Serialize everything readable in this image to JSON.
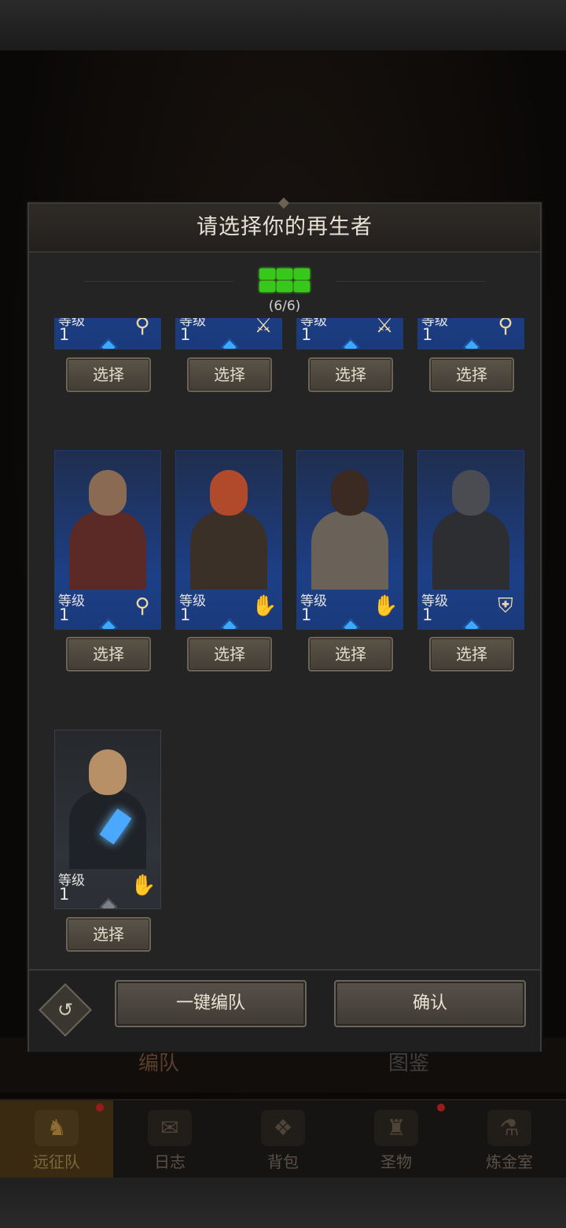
{
  "modal": {
    "title": "请选择你的再生者",
    "counter_text": "(6/6)",
    "counter_filled": 6,
    "counter_total": 6
  },
  "cards_row1": [
    {
      "level_label": "等级",
      "level": "1",
      "class_icon": "staff-icon",
      "select_label": "选择"
    },
    {
      "level_label": "等级",
      "level": "1",
      "class_icon": "sword-icon",
      "select_label": "选择"
    },
    {
      "level_label": "等级",
      "level": "1",
      "class_icon": "sword-icon",
      "select_label": "选择"
    },
    {
      "level_label": "等级",
      "level": "1",
      "class_icon": "staff-icon",
      "select_label": "选择"
    }
  ],
  "cards_row2": [
    {
      "level_label": "等级",
      "level": "1",
      "class_icon": "staff-icon",
      "select_label": "选择",
      "portrait": "bearded-pirate"
    },
    {
      "level_label": "等级",
      "level": "1",
      "class_icon": "palm-icon",
      "select_label": "选择",
      "portrait": "red-haired-woman"
    },
    {
      "level_label": "等级",
      "level": "1",
      "class_icon": "palm-icon",
      "select_label": "选择",
      "portrait": "dark-haired-elf"
    },
    {
      "level_label": "等级",
      "level": "1",
      "class_icon": "shield-icon",
      "select_label": "选择",
      "portrait": "armored-knight"
    }
  ],
  "cards_row3": [
    {
      "level_label": "等级",
      "level": "1",
      "class_icon": "palm-icon",
      "select_label": "选择",
      "portrait": "hooded-crystal-mage"
    }
  ],
  "footer": {
    "auto_team_label": "一键编队",
    "confirm_label": "确认"
  },
  "background": {
    "tab_left": "编队",
    "tab_right": "图鉴"
  },
  "nav": [
    {
      "label": "远征队",
      "icon": "horned-helmet-icon",
      "active": true
    },
    {
      "label": "日志",
      "icon": "map-scroll-icon",
      "active": false
    },
    {
      "label": "背包",
      "icon": "bag-icon",
      "active": false
    },
    {
      "label": "圣物",
      "icon": "chalice-icon",
      "active": false
    },
    {
      "label": "炼金室",
      "icon": "alchemy-icon",
      "active": false
    }
  ],
  "colors": {
    "counter_green": "#38c81c",
    "card_blue": "#1d3f86",
    "gem_blue": "#3aa9ff",
    "class_icon_gold": "#e9d7a8"
  }
}
